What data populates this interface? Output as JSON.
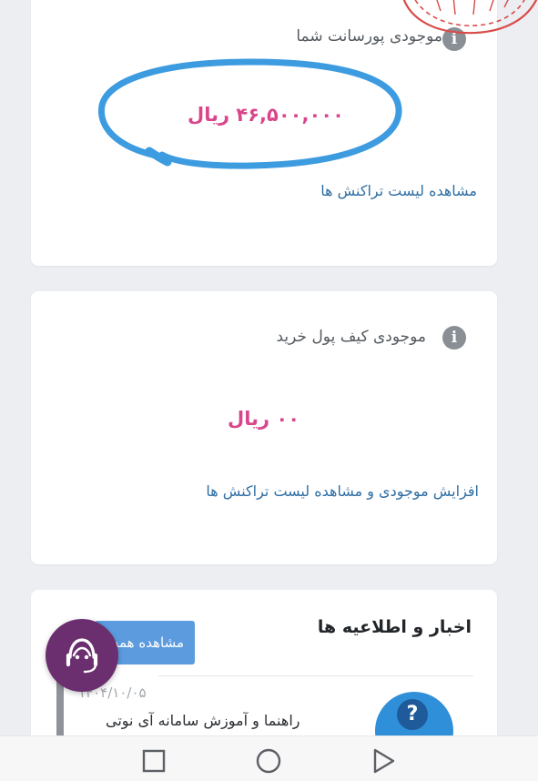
{
  "commission_card": {
    "title": "موجودی پورسانت شما",
    "amount": "۴۶,۵۰۰,۰۰۰ ریال",
    "link": "مشاهده لیست تراکنش ها"
  },
  "wallet_card": {
    "title": "موجودی کیف پول خرید",
    "amount": "۰۰ ریال",
    "link": "افزایش موجودی و مشاهده لیست تراکنش ها"
  },
  "news_card": {
    "title": "اخبار و اطلاعیه ها",
    "view_all_button": "مشاهده همه",
    "items": [
      {
        "date": "۱۴۰۴/۱۰/۰۵",
        "headline": "راهنما و آموزش سامانه آی نوتی"
      }
    ]
  },
  "icons": {
    "info": "info-icon",
    "support": "headset-support-icon",
    "help": "question-icon",
    "nav_recents": "square-icon",
    "nav_home": "circle-icon",
    "nav_back": "triangle-back-icon"
  },
  "colors": {
    "amount": "#d9468b",
    "link": "#2f6ea3",
    "annotation_circle": "#3d9be0",
    "support_button": "#6b2f6f",
    "view_all_button": "#5b9bde",
    "stamp": "#d94a4a"
  }
}
